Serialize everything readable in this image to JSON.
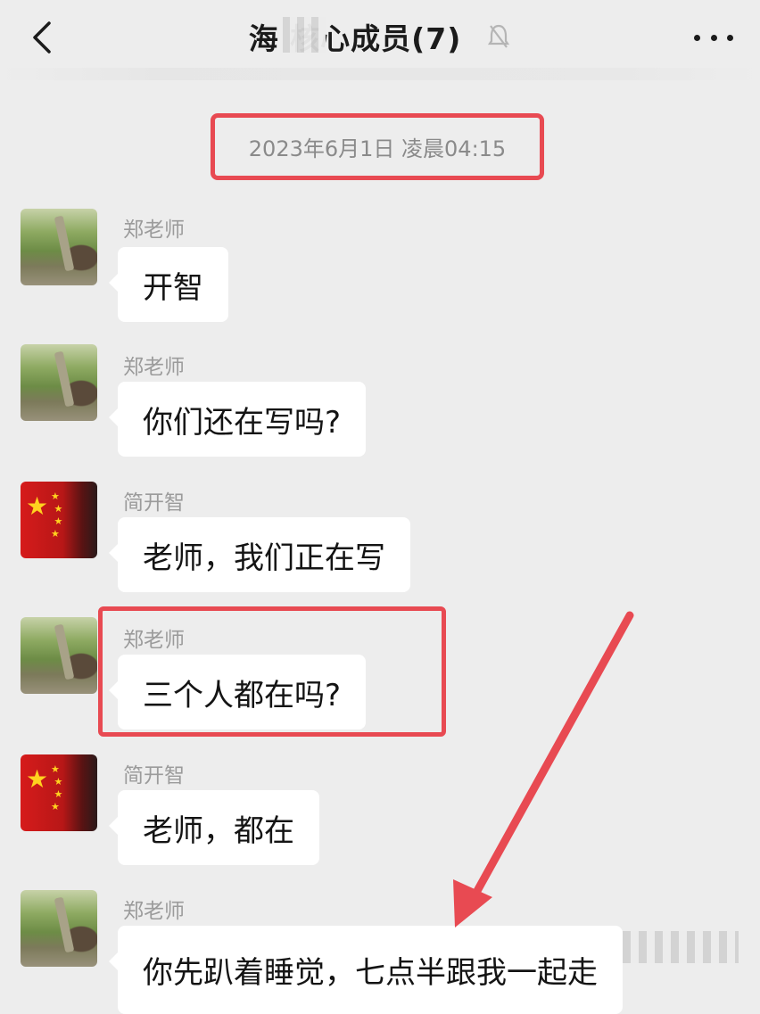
{
  "header": {
    "title": "海   核心成员(7)",
    "more_label": "···"
  },
  "timestamp": "2023年6月1日 凌晨04:15",
  "messages": [
    {
      "sender": "郑老师",
      "text": "开智",
      "avatar": "tree-avatar"
    },
    {
      "sender": "郑老师",
      "text": "你们还在写吗?",
      "avatar": "tree-avatar"
    },
    {
      "sender": "简开智",
      "text": "老师，我们正在写",
      "avatar": "flag-avatar"
    },
    {
      "sender": "郑老师",
      "text": "三个人都在吗?",
      "avatar": "tree-avatar"
    },
    {
      "sender": "简开智",
      "text": "老师，都在",
      "avatar": "flag-avatar"
    },
    {
      "sender": "郑老师",
      "text": "你先趴着睡觉，七点半跟我一起走",
      "avatar": "tree-avatar"
    }
  ],
  "colors": {
    "background": "#ededed",
    "bubble": "#ffffff",
    "annotation": "#e84a52",
    "sender_text": "#9b9b9b"
  },
  "icons": [
    "back-chevron-icon",
    "mute-bell-icon",
    "more-dots-icon",
    "annotation-arrow-icon"
  ]
}
